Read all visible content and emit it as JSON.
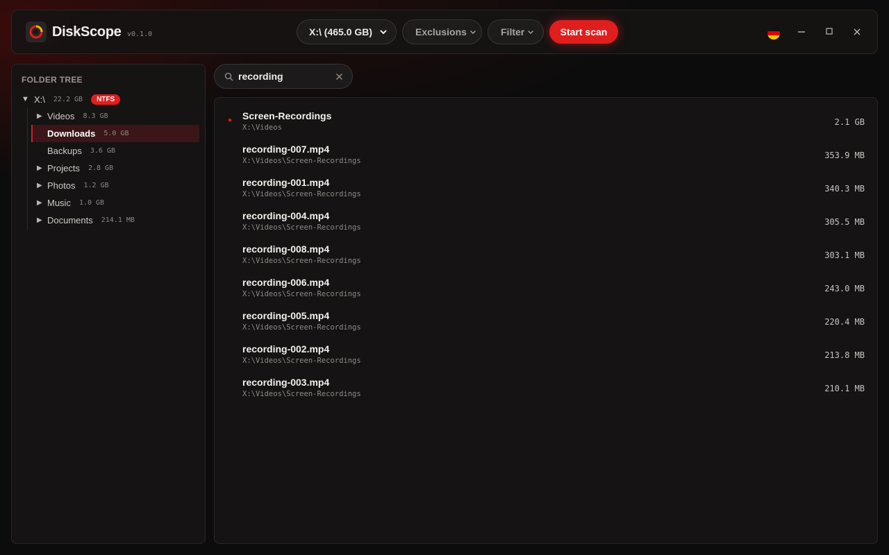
{
  "app": {
    "title": "DiskScope",
    "version": "v0.1.0"
  },
  "toolbar": {
    "drive": "X:\\ (465.0 GB)",
    "exclusions": "Exclusions",
    "filter": "Filter",
    "start_scan": "Start scan"
  },
  "colors": {
    "accent": "#e01e1e",
    "selected_bg": "#3b1517"
  },
  "sidebar": {
    "title": "FOLDER TREE",
    "root": {
      "label": "X:\\",
      "size": "22.2 GB",
      "badge": "NTFS"
    },
    "items": [
      {
        "label": "Videos",
        "size": "8.3 GB",
        "expandable": true
      },
      {
        "label": "Downloads",
        "size": "5.0 GB",
        "expandable": false,
        "selected": true
      },
      {
        "label": "Backups",
        "size": "3.6 GB",
        "expandable": false
      },
      {
        "label": "Projects",
        "size": "2.8 GB",
        "expandable": true
      },
      {
        "label": "Photos",
        "size": "1.2 GB",
        "expandable": true
      },
      {
        "label": "Music",
        "size": "1.0 GB",
        "expandable": true
      },
      {
        "label": "Documents",
        "size": "214.1 MB",
        "expandable": true
      }
    ]
  },
  "search": {
    "value": "recording",
    "icon": "search-icon",
    "clear_icon": "close-icon"
  },
  "results": [
    {
      "name": "Screen-Recordings",
      "path": "X:\\Videos",
      "size": "2.1 GB",
      "is_folder": true
    },
    {
      "name": "recording-007.mp4",
      "path": "X:\\Videos\\Screen-Recordings",
      "size": "353.9 MB"
    },
    {
      "name": "recording-001.mp4",
      "path": "X:\\Videos\\Screen-Recordings",
      "size": "340.3 MB"
    },
    {
      "name": "recording-004.mp4",
      "path": "X:\\Videos\\Screen-Recordings",
      "size": "305.5 MB"
    },
    {
      "name": "recording-008.mp4",
      "path": "X:\\Videos\\Screen-Recordings",
      "size": "303.1 MB"
    },
    {
      "name": "recording-006.mp4",
      "path": "X:\\Videos\\Screen-Recordings",
      "size": "243.0 MB"
    },
    {
      "name": "recording-005.mp4",
      "path": "X:\\Videos\\Screen-Recordings",
      "size": "220.4 MB"
    },
    {
      "name": "recording-002.mp4",
      "path": "X:\\Videos\\Screen-Recordings",
      "size": "213.8 MB"
    },
    {
      "name": "recording-003.mp4",
      "path": "X:\\Videos\\Screen-Recordings",
      "size": "210.1 MB"
    }
  ]
}
